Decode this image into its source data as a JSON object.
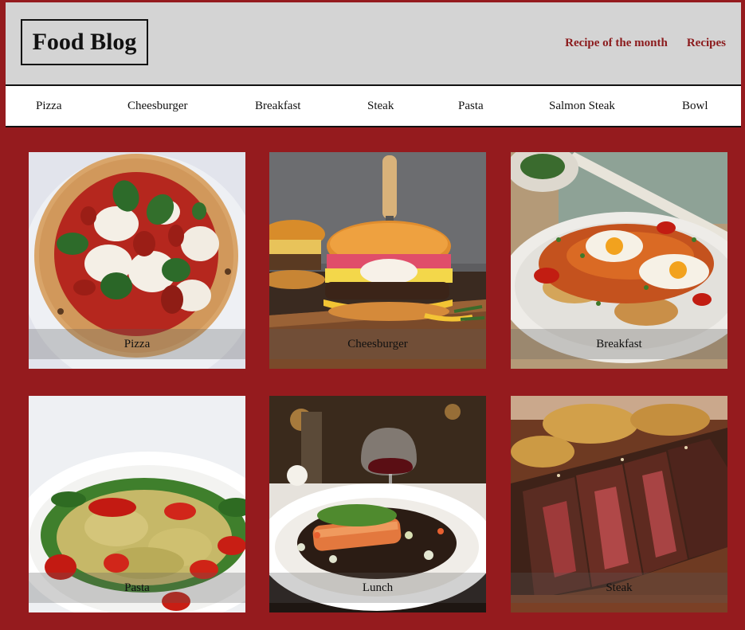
{
  "header": {
    "logo": "Food Blog",
    "links": [
      "Recipe of the month",
      "Recipes"
    ]
  },
  "menu": {
    "items": [
      "Pizza",
      "Cheesburger",
      "Breakfast",
      "Steak",
      "Pasta",
      "Salmon Steak",
      "Bowl"
    ]
  },
  "cards": [
    {
      "caption": "Pizza"
    },
    {
      "caption": "Cheesburger"
    },
    {
      "caption": "Breakfast"
    },
    {
      "caption": "Pasta"
    },
    {
      "caption": "Lunch"
    },
    {
      "caption": "Steak"
    }
  ],
  "colors": {
    "page_background": "#951b1e",
    "header_background": "#d4d4d4",
    "link_color": "#8b1a1c"
  }
}
